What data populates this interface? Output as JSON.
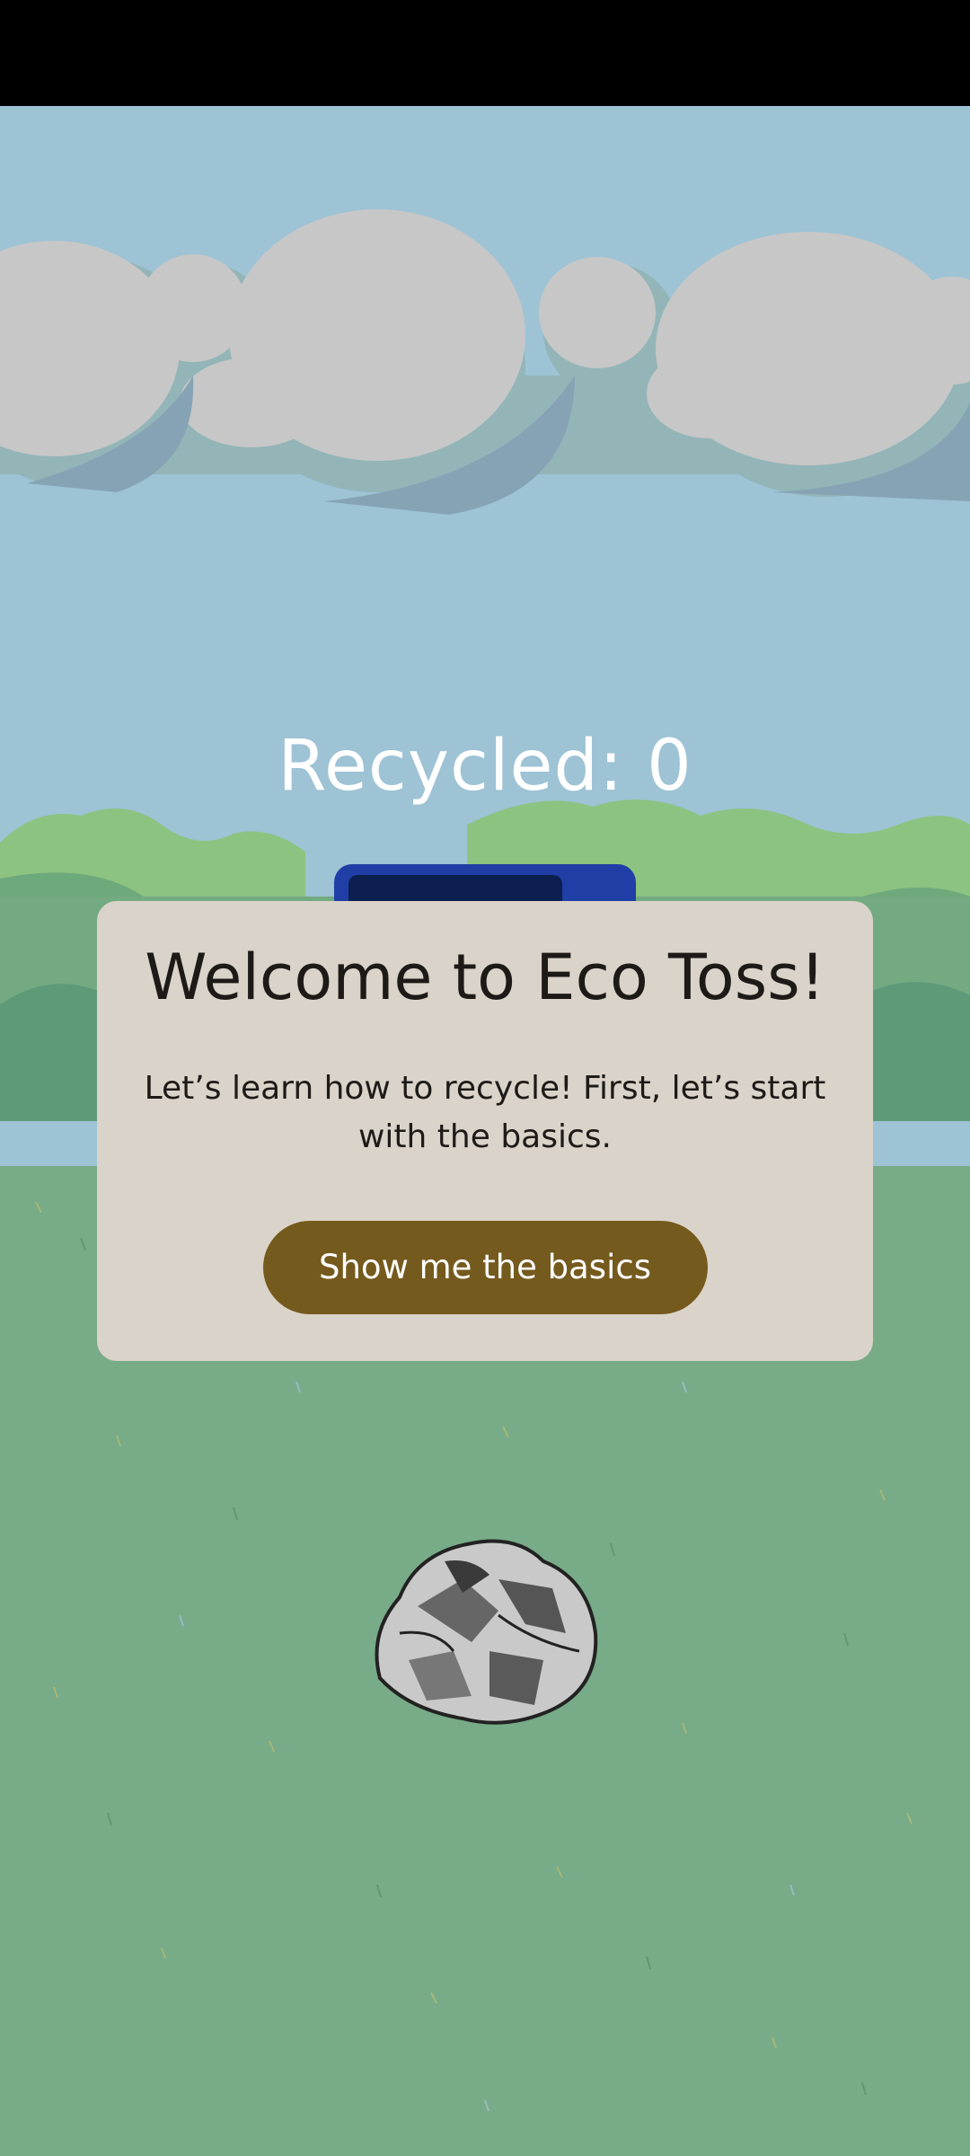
{
  "game": {
    "score_text": "Recycled: 0"
  },
  "welcome_modal": {
    "title": "Welcome to Eco Toss!",
    "message": "Let’s learn how to recycle! First, let’s start with the basics.",
    "button_label": "Show me the basics"
  },
  "colors": {
    "sky": "#9dc3d5",
    "cloud": "#c7c7c7",
    "grass": "#78ab88",
    "bushes": "#8cc381",
    "modal_bg": "#dad3c9",
    "button_bg": "#755a1d",
    "recycling_bin": "#1f3fa6"
  },
  "icons": {
    "item_to_toss": "crumpled-foil-ball-icon",
    "bin": "recycling-bin-icon"
  }
}
